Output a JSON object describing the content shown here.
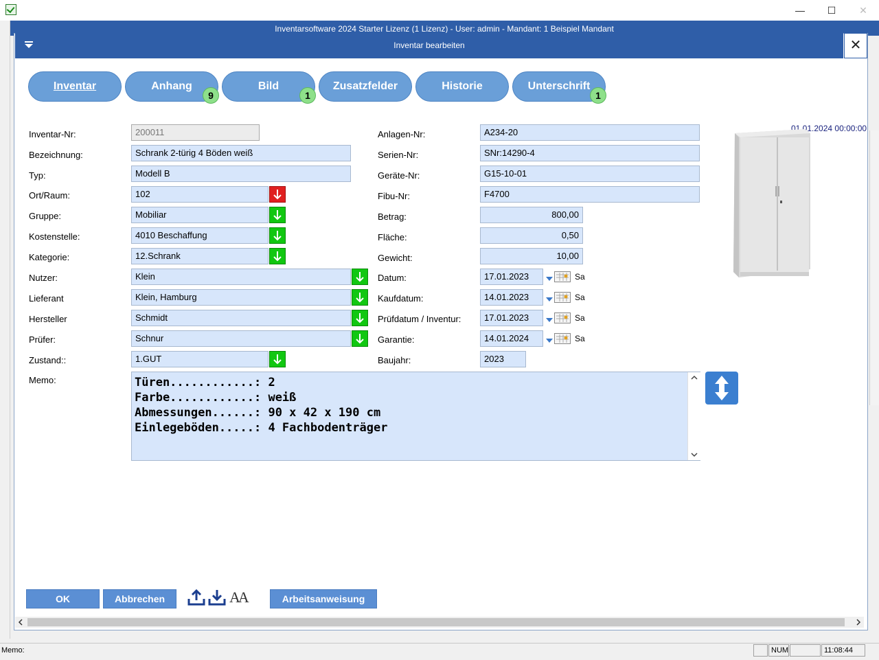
{
  "window": {
    "title": "Inventarsoftware 2024 Starter Lizenz (1 Lizenz) - User: admin - Mandant: 1 Beispiel Mandant",
    "minimize": "—",
    "maximize": "☐",
    "close": "✕"
  },
  "dialog": {
    "title": "Inventar bearbeiten",
    "close": "✕"
  },
  "tabs": [
    {
      "label": "Inventar",
      "badge": ""
    },
    {
      "label": "Anhang",
      "badge": "9"
    },
    {
      "label": "Bild",
      "badge": "1"
    },
    {
      "label": "Zusatzfelder",
      "badge": ""
    },
    {
      "label": "Historie",
      "badge": ""
    },
    {
      "label": "Unterschrift",
      "badge": "1"
    }
  ],
  "left_fields": {
    "inventar_nr": {
      "label": "Inventar-Nr:",
      "value": "200011"
    },
    "bezeichnung": {
      "label": "Bezeichnung:",
      "value": "Schrank 2-türig 4 Böden weiß"
    },
    "typ": {
      "label": "Typ:",
      "value": "Modell B"
    },
    "ort_raum": {
      "label": "Ort/Raum:",
      "value": "102"
    },
    "gruppe": {
      "label": "Gruppe:",
      "value": "Mobiliar"
    },
    "kostenstelle": {
      "label": "Kostenstelle:",
      "value": "4010 Beschaffung"
    },
    "kategorie": {
      "label": "Kategorie:",
      "value": "12.Schrank"
    },
    "nutzer": {
      "label": "Nutzer:",
      "value": "Klein"
    },
    "lieferant": {
      "label": "Lieferant",
      "value": "Klein, Hamburg"
    },
    "hersteller": {
      "label": "Hersteller",
      "value": "Schmidt"
    },
    "pruefer": {
      "label": "Prüfer:",
      "value": "Schnur"
    },
    "zustand": {
      "label": "Zustand::",
      "value": "1.GUT"
    },
    "memo": {
      "label": "Memo:"
    }
  },
  "right_fields": {
    "anlagen_nr": {
      "label": "Anlagen-Nr:",
      "value": "A234-20"
    },
    "serien_nr": {
      "label": "Serien-Nr:",
      "value": "SNr:14290-4"
    },
    "geraete_nr": {
      "label": "Geräte-Nr:",
      "value": "G15-10-01"
    },
    "fibu_nr": {
      "label": "Fibu-Nr:",
      "value": "F4700"
    },
    "betrag": {
      "label": "Betrag:",
      "value": "800,00"
    },
    "flaeche": {
      "label": "Fläche:",
      "value": "0,50"
    },
    "gewicht": {
      "label": "Gewicht:",
      "value": "10,00"
    },
    "datum": {
      "label": "Datum:",
      "value": "17.01.2023",
      "day": "Sa"
    },
    "kaufdatum": {
      "label": "Kaufdatum:",
      "value": "14.01.2023",
      "day": "Sa"
    },
    "pruefdatum": {
      "label": "Prüfdatum / Inventur:",
      "value": "17.01.2023",
      "day": "Sa"
    },
    "garantie": {
      "label": "Garantie:",
      "value": "14.01.2024",
      "day": "Sa"
    },
    "baujahr": {
      "label": "Baujahr:",
      "value": "2023"
    }
  },
  "memo_text": "Türen............: 2\nFarbe............: weiß\nAbmessungen......: 90 x 42 x 190 cm\nEinlegeböden.....: 4 Fachbodenträger",
  "image": {
    "timestamp": "01.01.2024 00:00:00"
  },
  "buttons": {
    "ok": "OK",
    "abbrechen": "Abbrechen",
    "arbeitsanweisung": "Arbeitsanweisung",
    "font_icon": "AA"
  },
  "statusbar": {
    "memo": "Memo:",
    "num": "NUM",
    "time": "11:08:44"
  },
  "colors": {
    "titlebar": "#2f5ea8",
    "tab": "#6a9fd8",
    "field": "#d7e6fb",
    "arrow_green": "#11c711",
    "arrow_red": "#e02020",
    "badge": "#8ee08a"
  }
}
